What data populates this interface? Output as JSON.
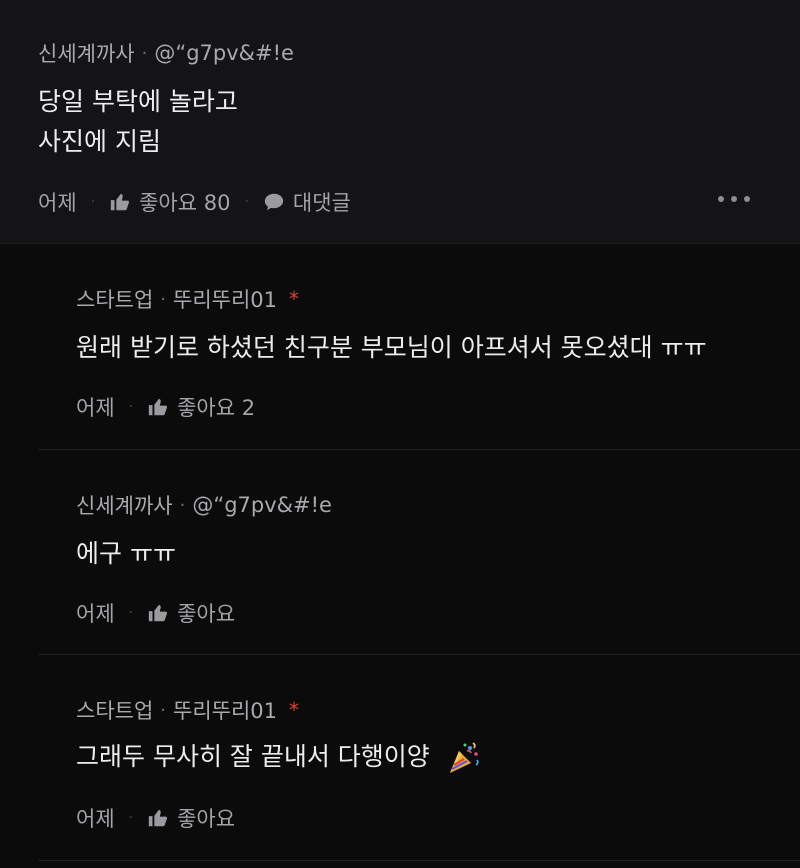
{
  "root_comment": {
    "author": "신세계까사",
    "handle": "@“g7pv&#!e",
    "lines": [
      "당일 부탁에 놀라고",
      "사진에 지림"
    ],
    "time": "어제",
    "like_label": "좋아요 80",
    "reply_label": "대댓글"
  },
  "replies": [
    {
      "author": "스타트업",
      "handle": "뚜리뚜리01",
      "star": "*",
      "text": "원래 받기로 하셨던 친구분 부모님이 아프셔서 못오셨대 ㅠㅠ",
      "time": "어제",
      "like_label": "좋아요 2"
    },
    {
      "author": "신세계까사",
      "handle": "@“g7pv&#!e",
      "text": "에구 ㅠㅠ",
      "time": "어제",
      "like_label": "좋아요"
    },
    {
      "author": "스타트업",
      "handle": "뚜리뚜리01",
      "star": "*",
      "text": "그래두 무사히 잘 끝내서 다행이양",
      "time": "어제",
      "like_label": "좋아요"
    }
  ],
  "separator_dot": "·",
  "action_sep": "·"
}
